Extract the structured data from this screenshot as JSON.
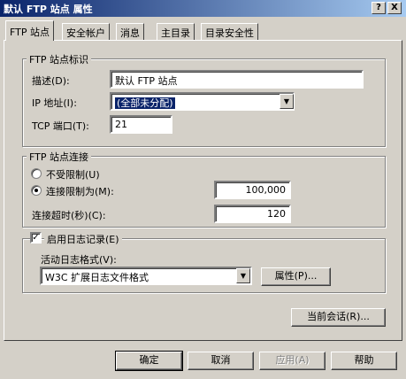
{
  "window": {
    "title": "默认 FTP 站点 属性",
    "help_btn": "?",
    "close_btn": "X"
  },
  "tabs": [
    "FTP 站点",
    "安全帐户",
    "消息",
    "主目录",
    "目录安全性"
  ],
  "identification": {
    "group_label": "FTP 站点标识",
    "desc_label": "描述(D):",
    "desc_value": "默认 FTP 站点",
    "ip_label": "IP 地址(I):",
    "ip_value": "(全部未分配)",
    "port_label": "TCP 端口(T):",
    "port_value": "21"
  },
  "connection": {
    "group_label": "FTP 站点连接",
    "unlimited_label": "不受限制(U)",
    "limited_label": "连接限制为(M):",
    "limit_value": "100,000",
    "timeout_label": "连接超时(秒)(C):",
    "timeout_value": "120"
  },
  "logging": {
    "enable_label": "启用日志记录(E)",
    "format_label": "活动日志格式(V):",
    "format_value": "W3C 扩展日志文件格式",
    "properties_button": "属性(P)..."
  },
  "sessions_button": "当前会话(R)...",
  "footer": {
    "ok": "确定",
    "cancel": "取消",
    "apply": "应用(A)",
    "help": "帮助"
  }
}
